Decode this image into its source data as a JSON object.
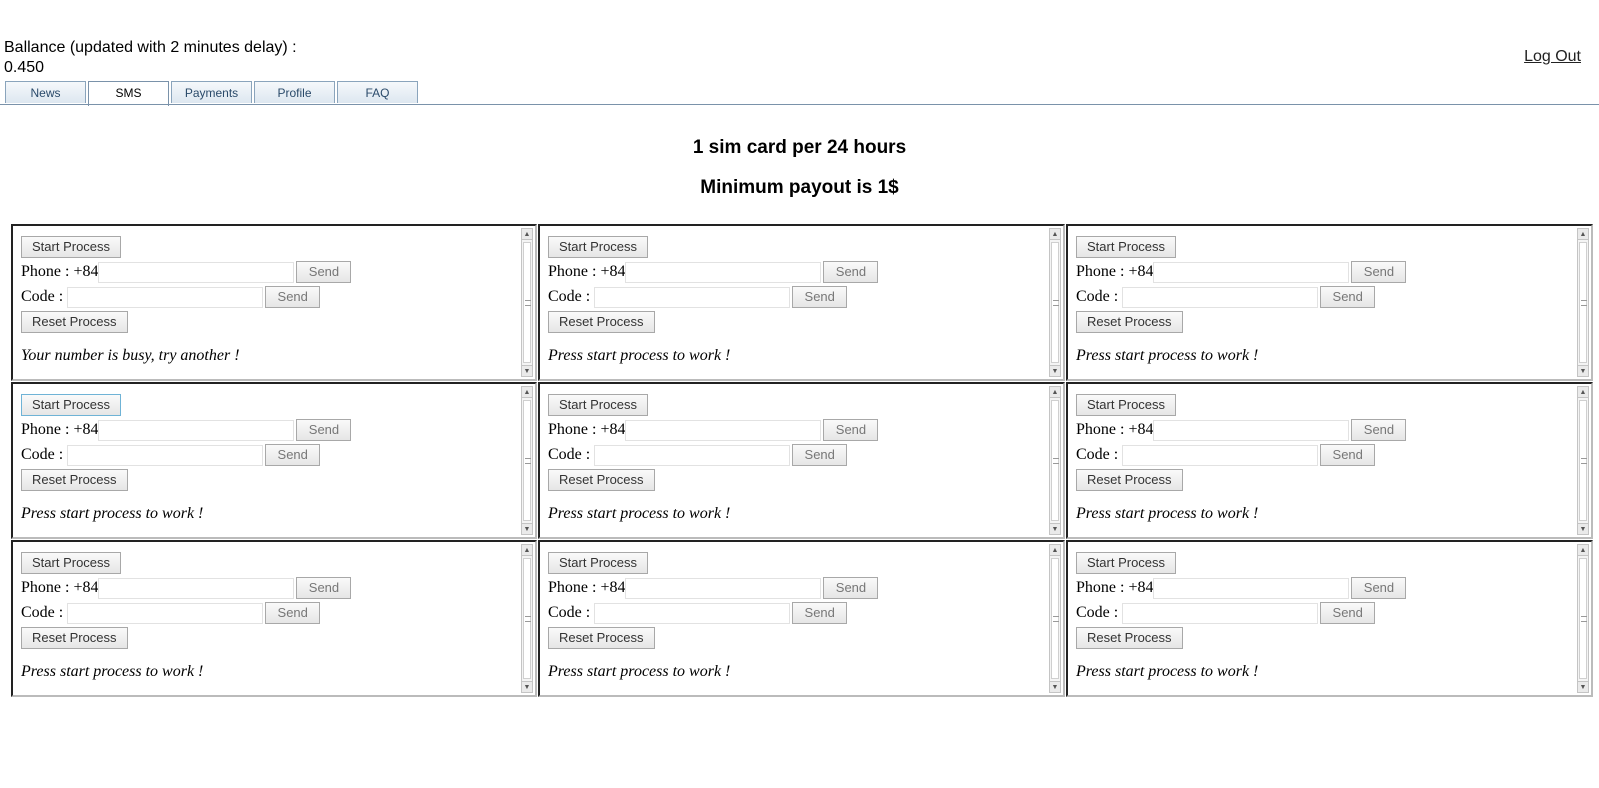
{
  "header": {
    "balance_label": "Ballance (updated with 2 minutes delay) :",
    "balance_value": "0.450",
    "logout_label": "Log Out"
  },
  "tabs": [
    {
      "label": "News"
    },
    {
      "label": "SMS"
    },
    {
      "label": "Payments"
    },
    {
      "label": "Profile"
    },
    {
      "label": "FAQ"
    }
  ],
  "active_tab": "SMS",
  "notices": {
    "line1": "1 sim card per 24 hours",
    "line2": "Minimum payout is 1$"
  },
  "panel_labels": {
    "start": "Start Process",
    "phone": "Phone : +84",
    "code": "Code :",
    "send": "Send",
    "reset": "Reset Process"
  },
  "panels": [
    {
      "status": "Your number is busy, try another !"
    },
    {
      "status": "Press start process to work !"
    },
    {
      "status": "Press start process to work !"
    },
    {
      "status": "Press start process to work !"
    },
    {
      "status": "Press start process to work !"
    },
    {
      "status": "Press start process to work !"
    },
    {
      "status": "Press start process to work !"
    },
    {
      "status": "Press start process to work !"
    },
    {
      "status": "Press start process to work !"
    }
  ],
  "icons": {
    "scroll_up": "scroll-up-arrow-icon",
    "scroll_down": "scroll-down-arrow-icon"
  }
}
